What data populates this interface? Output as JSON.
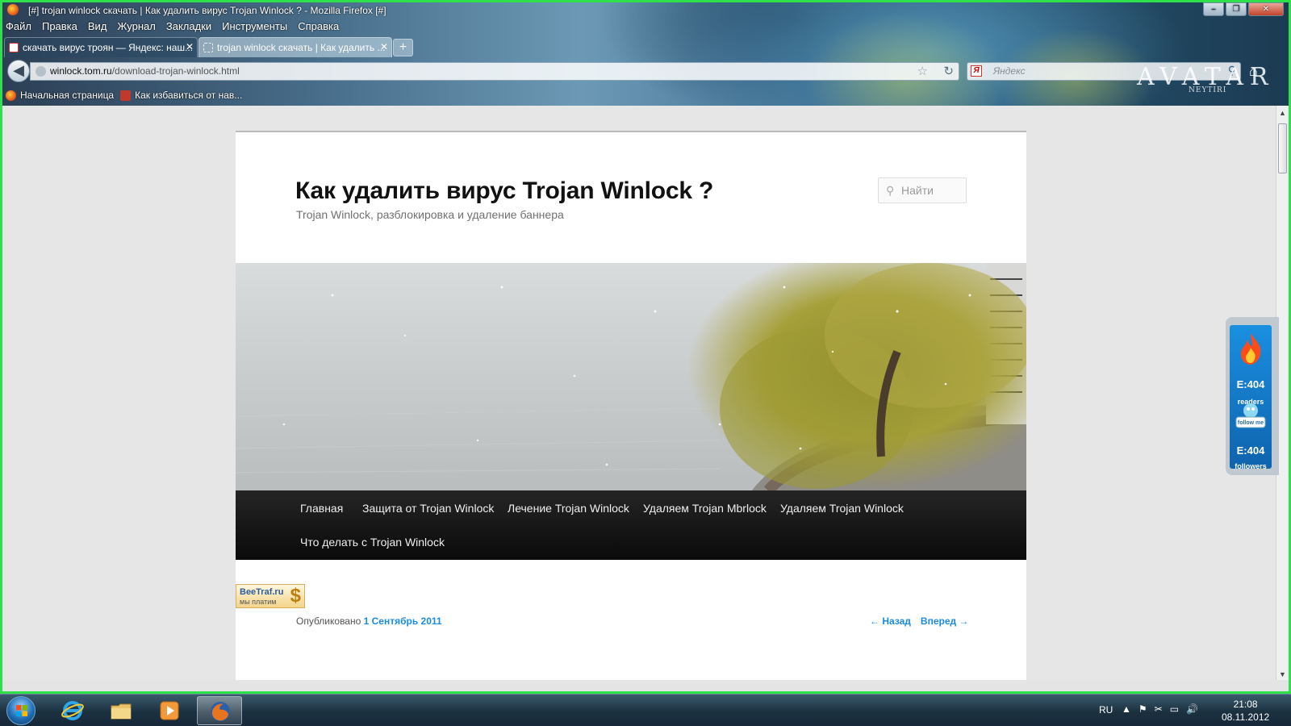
{
  "window": {
    "title": "[#] trojan winlock скачать | Как удалить вирус Trojan Winlock ? - Mozilla Firefox [#]",
    "controls": [
      "–",
      "❐",
      "✕"
    ]
  },
  "menu": [
    "Файл",
    "Правка",
    "Вид",
    "Журнал",
    "Закладки",
    "Инструменты",
    "Справка"
  ],
  "tabs": [
    {
      "label": "скачать вирус троян — Яндекс: наш...",
      "active": false,
      "close": "✕"
    },
    {
      "label": "trojan winlock скачать | Как удалить ...",
      "active": true,
      "close": "✕"
    }
  ],
  "new_tab": "+",
  "url": {
    "domain": "winlock.tom.ru",
    "path": "/download-trojan-winlock.html"
  },
  "search": {
    "engine_letter": "Я",
    "placeholder": "Яндекс"
  },
  "theme_brand": {
    "title": "AVATAR",
    "subtitle": "NEYTIRI"
  },
  "bookmarks": [
    "Начальная страница",
    "Как избавиться от нав..."
  ],
  "site": {
    "title": "Как удалить вирус Trojan Winlock ?",
    "description": "Trojan Winlock, разблокировка и удаление баннера",
    "search_placeholder": "Найти",
    "nav": [
      "Главная",
      "Защита от Trojan Winlock",
      "Лечение Trojan Winlock",
      "Удаляем Trojan Mbrlock",
      "Удаляем Trojan Winlock",
      "Что делать с Trojan Winlock"
    ]
  },
  "beetraf": {
    "name": "BeeTraf.ru",
    "tagline": "мы платим",
    "symbol": "$"
  },
  "post_meta": {
    "prefix": "Опубликовано",
    "date": "1 Сентябрь 2011",
    "prev": "← Назад",
    "next": "Вперед →"
  },
  "side_widget": {
    "readers_count": "E:404",
    "readers_label": "readers",
    "followers_count": "E:404",
    "followers_label": "followers",
    "bird_label": "follow me"
  },
  "taskbar": {
    "language": "RU",
    "tray": [
      "▲",
      "⚑",
      "✂",
      "▭",
      "🔊"
    ],
    "time": "21:08",
    "date": "08.11.2012"
  },
  "colors": {
    "frame": "#2ee04a",
    "link": "#1b8be0",
    "nav_bg": "#111111"
  }
}
